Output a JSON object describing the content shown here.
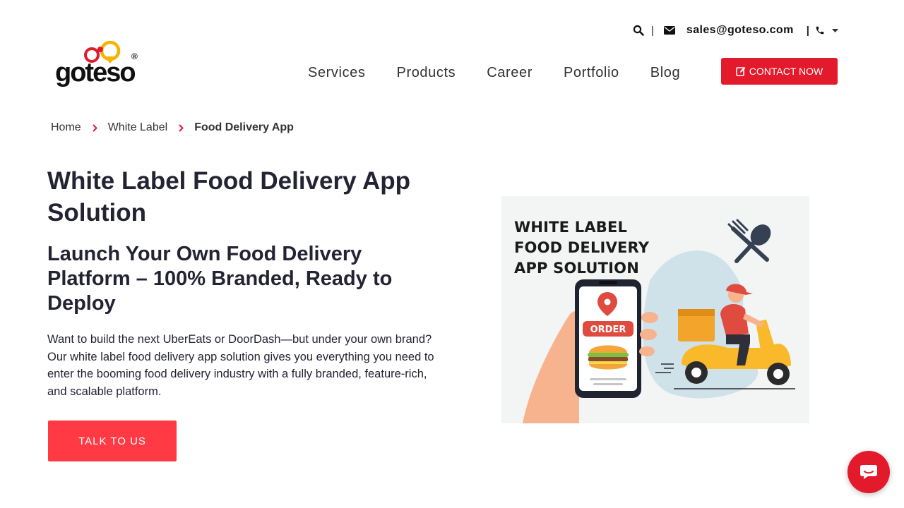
{
  "topbar": {
    "separator": "|",
    "email": "sales@goteso.com"
  },
  "brand": {
    "logo_text": "goteso",
    "registered": "®",
    "primary_color": "#e3192c",
    "accent_color": "#f4b400"
  },
  "nav": {
    "items": [
      "Services",
      "Products",
      "Career",
      "Portfolio",
      "Blog"
    ],
    "contact_label": "CONTACT NOW"
  },
  "breadcrumb": {
    "items": [
      "Home",
      "White Label"
    ],
    "current": "Food Delivery App"
  },
  "hero": {
    "title": "White Label Food Delivery App Solution",
    "subtitle": "Launch Your Own Food Delivery Platform – 100% Branded, Ready to Deploy",
    "description": "Want to build the next UberEats or DoorDash—but under your own brand? Our white label food delivery app solution gives you everything you need to enter the booming food delivery industry with a fully branded, feature-rich, and scalable platform.",
    "cta_label": "TALK TO US"
  },
  "illustration": {
    "title_lines": [
      "WHITE LABEL",
      "FOOD DELIVERY",
      "APP SOLUTION"
    ],
    "order_label": "ORDER"
  },
  "icons": {
    "search": "search-icon",
    "email": "envelope-icon",
    "phone": "phone-icon",
    "dropdown": "caret-down-icon",
    "edit": "edit-icon",
    "breadcrumb_sep": "chevron-right-icon",
    "chat": "chat-icon"
  }
}
